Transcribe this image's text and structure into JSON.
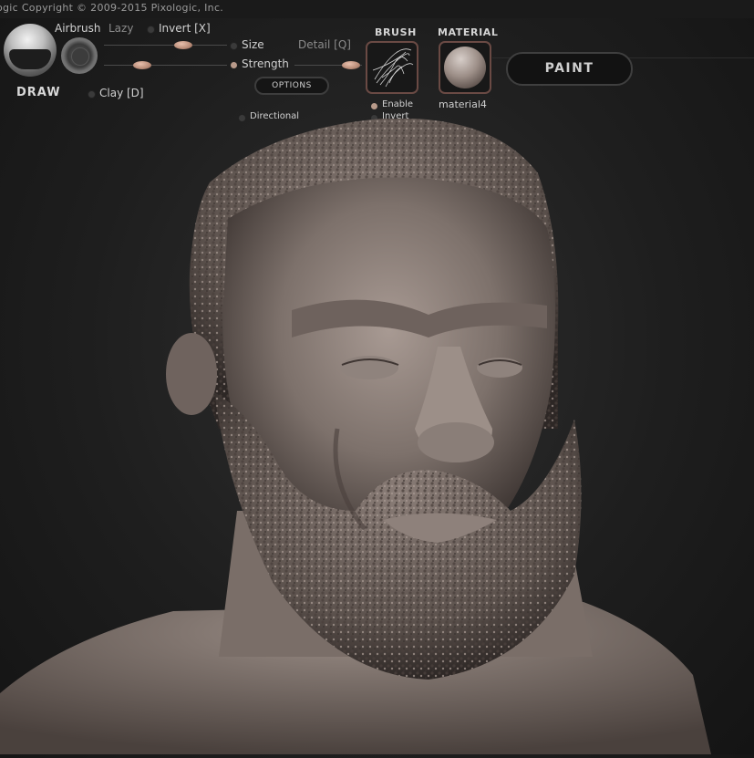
{
  "header": {
    "copyright": "ogic   Copyright © 2009-2015 Pixologic, Inc."
  },
  "toolbar": {
    "brush_type": "DRAW",
    "airbrush_label": "Airbrush",
    "lazy_label": "Lazy",
    "invert_label": "Invert [X]",
    "size_label": "Size",
    "detail_label": "Detail [Q]",
    "strength_label": "Strength",
    "clay_label": "Clay [D]",
    "options_label": "OPTIONS",
    "directional_label": "Directional"
  },
  "brush_panel": {
    "title": "BRUSH",
    "enable_label": "Enable",
    "invert_label": "Invert"
  },
  "material_panel": {
    "title": "MATERIAL",
    "name": "material4"
  },
  "paint_button": {
    "label": "PAINT"
  },
  "colors": {
    "background": "#1e1e1e",
    "accent": "#b88b77",
    "sculpt": "#8a7e78"
  }
}
